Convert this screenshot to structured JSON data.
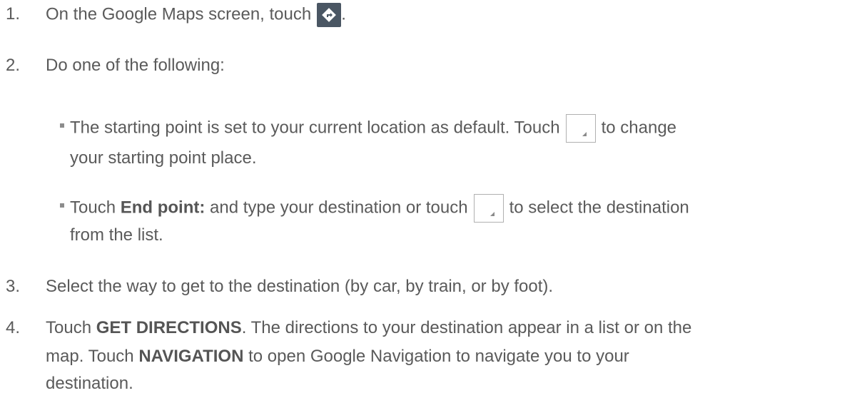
{
  "steps": [
    {
      "num": "1.",
      "pre": "On the Google Maps screen, touch",
      "post": "."
    },
    {
      "num": "2.",
      "text": "Do one of the following:"
    },
    {
      "num": "3.",
      "text": "Select the way to get to the destination (by car, by train, or by foot)."
    },
    {
      "num": "4.",
      "pre": "Touch ",
      "bold1": "GET DIRECTIONS",
      "mid1": ". The directions to your destination appear in a list or on the",
      "line2": "map. Touch ",
      "bold2": "NAVIGATION",
      "mid2": " to open Google Navigation to navigate you to your",
      "line3": "destination."
    }
  ],
  "bullets": [
    {
      "pre": "The starting point is set to your current location as default. Touch",
      "post": "to change",
      "line2": "your starting point place."
    },
    {
      "pre": "Touch ",
      "bold": "End point:",
      "mid": " and type your destination or touch",
      "post": "to select the destination",
      "line2": "from the list."
    }
  ],
  "icons": {
    "directions": "directions-icon",
    "dropdown": "dropdown-icon"
  }
}
